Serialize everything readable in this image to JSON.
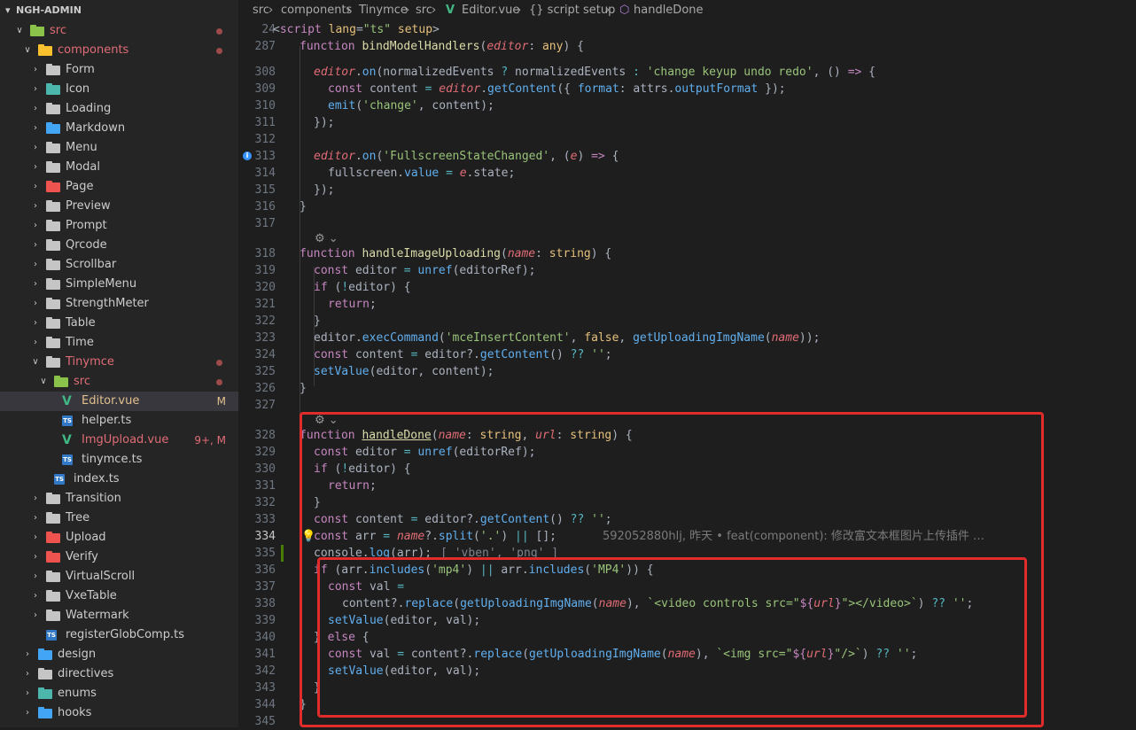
{
  "explorer": {
    "root": "NGH-ADMIN",
    "items": [
      {
        "label": "src",
        "icon": "src-folder",
        "open": true,
        "color": "#e06c75",
        "dot": true
      },
      {
        "label": "components",
        "icon": "components-folder",
        "open": true,
        "color": "#e06c75",
        "dot": true
      },
      {
        "label": "Form",
        "icon": "folder"
      },
      {
        "label": "Icon",
        "icon": "folder-teal"
      },
      {
        "label": "Loading",
        "icon": "folder"
      },
      {
        "label": "Markdown",
        "icon": "folder-blue"
      },
      {
        "label": "Menu",
        "icon": "folder"
      },
      {
        "label": "Modal",
        "icon": "folder"
      },
      {
        "label": "Page",
        "icon": "folder-red"
      },
      {
        "label": "Preview",
        "icon": "folder"
      },
      {
        "label": "Prompt",
        "icon": "folder"
      },
      {
        "label": "Qrcode",
        "icon": "folder"
      },
      {
        "label": "Scrollbar",
        "icon": "folder"
      },
      {
        "label": "SimpleMenu",
        "icon": "folder"
      },
      {
        "label": "StrengthMeter",
        "icon": "folder"
      },
      {
        "label": "Table",
        "icon": "folder"
      },
      {
        "label": "Time",
        "icon": "folder"
      },
      {
        "label": "Tinymce",
        "icon": "folder",
        "open": true,
        "color": "#e06c75",
        "dot": true
      },
      {
        "label": "src",
        "icon": "src-folder",
        "open": true,
        "color": "#e06c75",
        "dot": true
      },
      {
        "label": "Editor.vue",
        "icon": "vue",
        "badge": "M",
        "color": "#e2c08d"
      },
      {
        "label": "helper.ts",
        "icon": "ts"
      },
      {
        "label": "ImgUpload.vue",
        "icon": "vue",
        "badge": "9+, M",
        "color": "#e06c75"
      },
      {
        "label": "tinymce.ts",
        "icon": "ts"
      },
      {
        "label": "index.ts",
        "icon": "ts"
      },
      {
        "label": "Transition",
        "icon": "folder"
      },
      {
        "label": "Tree",
        "icon": "folder"
      },
      {
        "label": "Upload",
        "icon": "folder-red"
      },
      {
        "label": "Verify",
        "icon": "folder-red"
      },
      {
        "label": "VirtualScroll",
        "icon": "folder"
      },
      {
        "label": "VxeTable",
        "icon": "folder"
      },
      {
        "label": "Watermark",
        "icon": "folder"
      },
      {
        "label": "registerGlobComp.ts",
        "icon": "ts"
      },
      {
        "label": "design",
        "icon": "folder-blue"
      },
      {
        "label": "directives",
        "icon": "folder"
      },
      {
        "label": "enums",
        "icon": "folder-teal"
      },
      {
        "label": "hooks",
        "icon": "folder-blue"
      }
    ]
  },
  "breadcrumbs": [
    "src",
    "components",
    "Tinymce",
    "src",
    "Editor.vue",
    "{} script setup",
    "handleDone"
  ],
  "editor": {
    "script_tag": "<script lang=\"ts\" setup>",
    "blame": "592052880hlj, 昨天 • feat(component): 修改富文本框图片上传插件 …",
    "inlay_hint": "[ 'vben', 'png' ]"
  },
  "colors": {
    "highlight_box": "#e22b2b",
    "accent": "#0e639c"
  }
}
